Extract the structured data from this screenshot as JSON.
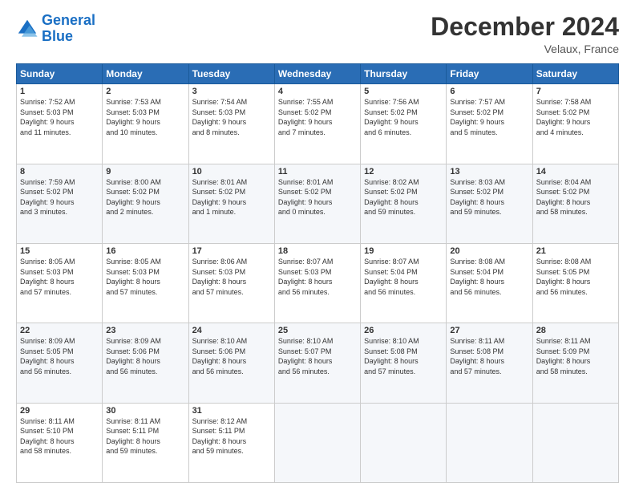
{
  "header": {
    "logo_general": "General",
    "logo_blue": "Blue",
    "month": "December 2024",
    "location": "Velaux, France"
  },
  "weekdays": [
    "Sunday",
    "Monday",
    "Tuesday",
    "Wednesday",
    "Thursday",
    "Friday",
    "Saturday"
  ],
  "weeks": [
    [
      {
        "day": 1,
        "rise": "7:52 AM",
        "set": "5:03 PM",
        "hours": "9 hours",
        "mins": "11 minutes"
      },
      {
        "day": 2,
        "rise": "7:53 AM",
        "set": "5:03 PM",
        "hours": "9 hours",
        "mins": "10 minutes"
      },
      {
        "day": 3,
        "rise": "7:54 AM",
        "set": "5:03 PM",
        "hours": "9 hours",
        "mins": "8 minutes"
      },
      {
        "day": 4,
        "rise": "7:55 AM",
        "set": "5:02 PM",
        "hours": "9 hours",
        "mins": "7 minutes"
      },
      {
        "day": 5,
        "rise": "7:56 AM",
        "set": "5:02 PM",
        "hours": "9 hours",
        "mins": "6 minutes"
      },
      {
        "day": 6,
        "rise": "7:57 AM",
        "set": "5:02 PM",
        "hours": "9 hours",
        "mins": "5 minutes"
      },
      {
        "day": 7,
        "rise": "7:58 AM",
        "set": "5:02 PM",
        "hours": "9 hours",
        "mins": "4 minutes"
      }
    ],
    [
      {
        "day": 8,
        "rise": "7:59 AM",
        "set": "5:02 PM",
        "hours": "9 hours",
        "mins": "3 minutes"
      },
      {
        "day": 9,
        "rise": "8:00 AM",
        "set": "5:02 PM",
        "hours": "9 hours",
        "mins": "2 minutes"
      },
      {
        "day": 10,
        "rise": "8:01 AM",
        "set": "5:02 PM",
        "hours": "9 hours",
        "mins": "1 minute"
      },
      {
        "day": 11,
        "rise": "8:01 AM",
        "set": "5:02 PM",
        "hours": "9 hours",
        "mins": "0 minutes"
      },
      {
        "day": 12,
        "rise": "8:02 AM",
        "set": "5:02 PM",
        "hours": "8 hours",
        "mins": "59 minutes"
      },
      {
        "day": 13,
        "rise": "8:03 AM",
        "set": "5:02 PM",
        "hours": "8 hours",
        "mins": "59 minutes"
      },
      {
        "day": 14,
        "rise": "8:04 AM",
        "set": "5:02 PM",
        "hours": "8 hours",
        "mins": "58 minutes"
      }
    ],
    [
      {
        "day": 15,
        "rise": "8:05 AM",
        "set": "5:03 PM",
        "hours": "8 hours",
        "mins": "57 minutes"
      },
      {
        "day": 16,
        "rise": "8:05 AM",
        "set": "5:03 PM",
        "hours": "8 hours",
        "mins": "57 minutes"
      },
      {
        "day": 17,
        "rise": "8:06 AM",
        "set": "5:03 PM",
        "hours": "8 hours",
        "mins": "57 minutes"
      },
      {
        "day": 18,
        "rise": "8:07 AM",
        "set": "5:03 PM",
        "hours": "8 hours",
        "mins": "56 minutes"
      },
      {
        "day": 19,
        "rise": "8:07 AM",
        "set": "5:04 PM",
        "hours": "8 hours",
        "mins": "56 minutes"
      },
      {
        "day": 20,
        "rise": "8:08 AM",
        "set": "5:04 PM",
        "hours": "8 hours",
        "mins": "56 minutes"
      },
      {
        "day": 21,
        "rise": "8:08 AM",
        "set": "5:05 PM",
        "hours": "8 hours",
        "mins": "56 minutes"
      }
    ],
    [
      {
        "day": 22,
        "rise": "8:09 AM",
        "set": "5:05 PM",
        "hours": "8 hours",
        "mins": "56 minutes"
      },
      {
        "day": 23,
        "rise": "8:09 AM",
        "set": "5:06 PM",
        "hours": "8 hours",
        "mins": "56 minutes"
      },
      {
        "day": 24,
        "rise": "8:10 AM",
        "set": "5:06 PM",
        "hours": "8 hours",
        "mins": "56 minutes"
      },
      {
        "day": 25,
        "rise": "8:10 AM",
        "set": "5:07 PM",
        "hours": "8 hours",
        "mins": "56 minutes"
      },
      {
        "day": 26,
        "rise": "8:10 AM",
        "set": "5:08 PM",
        "hours": "8 hours",
        "mins": "57 minutes"
      },
      {
        "day": 27,
        "rise": "8:11 AM",
        "set": "5:08 PM",
        "hours": "8 hours",
        "mins": "57 minutes"
      },
      {
        "day": 28,
        "rise": "8:11 AM",
        "set": "5:09 PM",
        "hours": "8 hours",
        "mins": "58 minutes"
      }
    ],
    [
      {
        "day": 29,
        "rise": "8:11 AM",
        "set": "5:10 PM",
        "hours": "8 hours",
        "mins": "58 minutes"
      },
      {
        "day": 30,
        "rise": "8:11 AM",
        "set": "5:11 PM",
        "hours": "8 hours",
        "mins": "59 minutes"
      },
      {
        "day": 31,
        "rise": "8:12 AM",
        "set": "5:11 PM",
        "hours": "8 hours",
        "mins": "59 minutes"
      },
      null,
      null,
      null,
      null
    ]
  ]
}
